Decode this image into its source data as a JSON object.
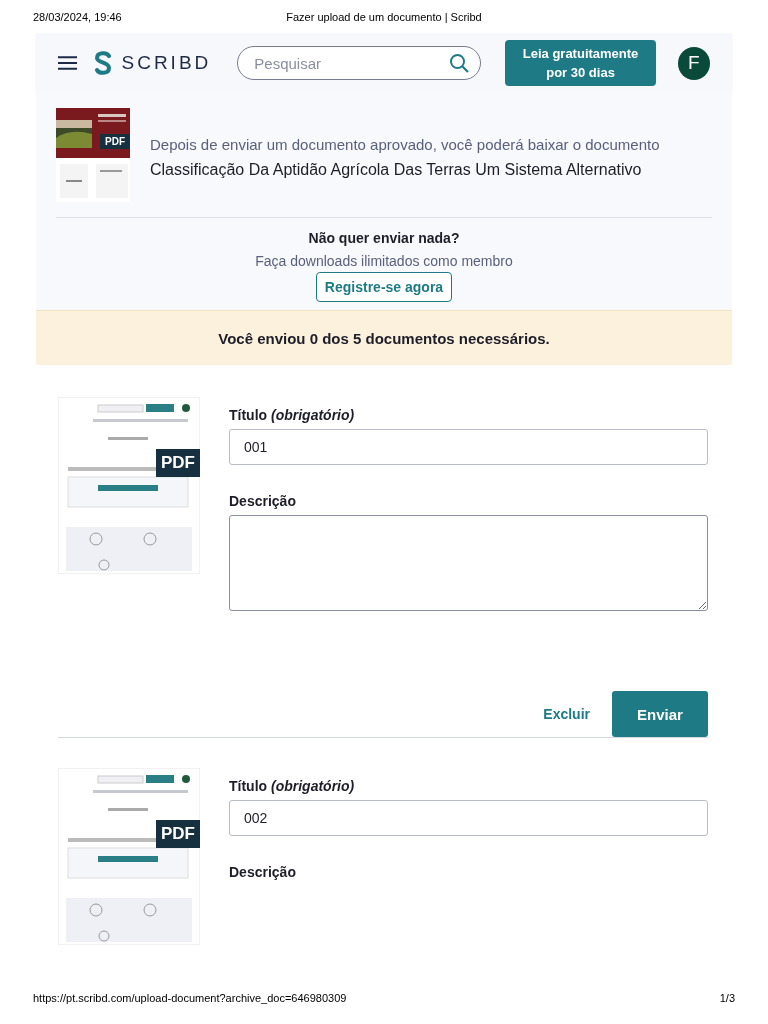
{
  "print_header": {
    "date": "28/03/2024, 19:46",
    "title": "Fazer upload de um documento | Scribd"
  },
  "header": {
    "logo": "SCRIBD",
    "search_placeholder": "Pesquisar",
    "cta": "Leia gratuitamente por 30 dias",
    "avatar": "F"
  },
  "document": {
    "badge": "PDF",
    "note": "Depois de enviar um documento aprovado, você poderá baixar o documento",
    "title": "Classificação Da Aptidão Agrícola Das Terras Um Sistema Alternativo"
  },
  "signup": {
    "question": "Não quer enviar nada?",
    "subtext": "Faça downloads ilimitados como membro",
    "button": "Registre-se agora"
  },
  "banner": "Você enviou 0 dos 5 documentos necessários.",
  "uploads": [
    {
      "badge": "PDF",
      "title_label": "Título *(obrigatório)*",
      "title_value": "001",
      "description_label": "Descrição",
      "description_box_visible": true,
      "delete": "Excluir",
      "submit": "Enviar"
    },
    {
      "badge": "PDF",
      "title_label": "Título *(obrigatório)*",
      "title_value": "002",
      "description_label": "Descrição",
      "description_box_visible": false
    }
  ],
  "print_footer": {
    "url": "https://pt.scribd.com/upload-document?archive_doc=646980309",
    "page": "1/3"
  }
}
